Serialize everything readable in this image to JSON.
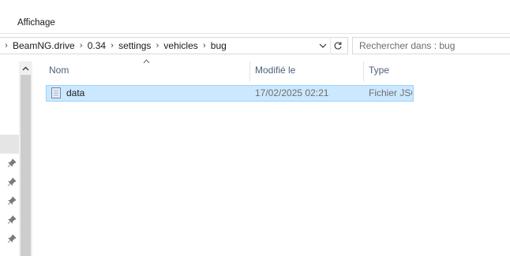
{
  "ribbon": {
    "tab_label": "Affichage"
  },
  "address": {
    "crumbs": [
      "BeamNG.drive",
      "0.34",
      "settings",
      "vehicles",
      "bug"
    ]
  },
  "search": {
    "placeholder": "Rechercher dans : bug"
  },
  "columns": {
    "name": "Nom",
    "modified": "Modifié le",
    "type": "Type"
  },
  "files": [
    {
      "name": "data",
      "modified": "17/02/2025 02:21",
      "type": "Fichier JSON",
      "icon": "json-file-icon",
      "selected": true
    }
  ],
  "colors": {
    "selection_bg": "#cce8ff",
    "selection_border": "#99d1ff",
    "header_text": "#4c607a"
  }
}
